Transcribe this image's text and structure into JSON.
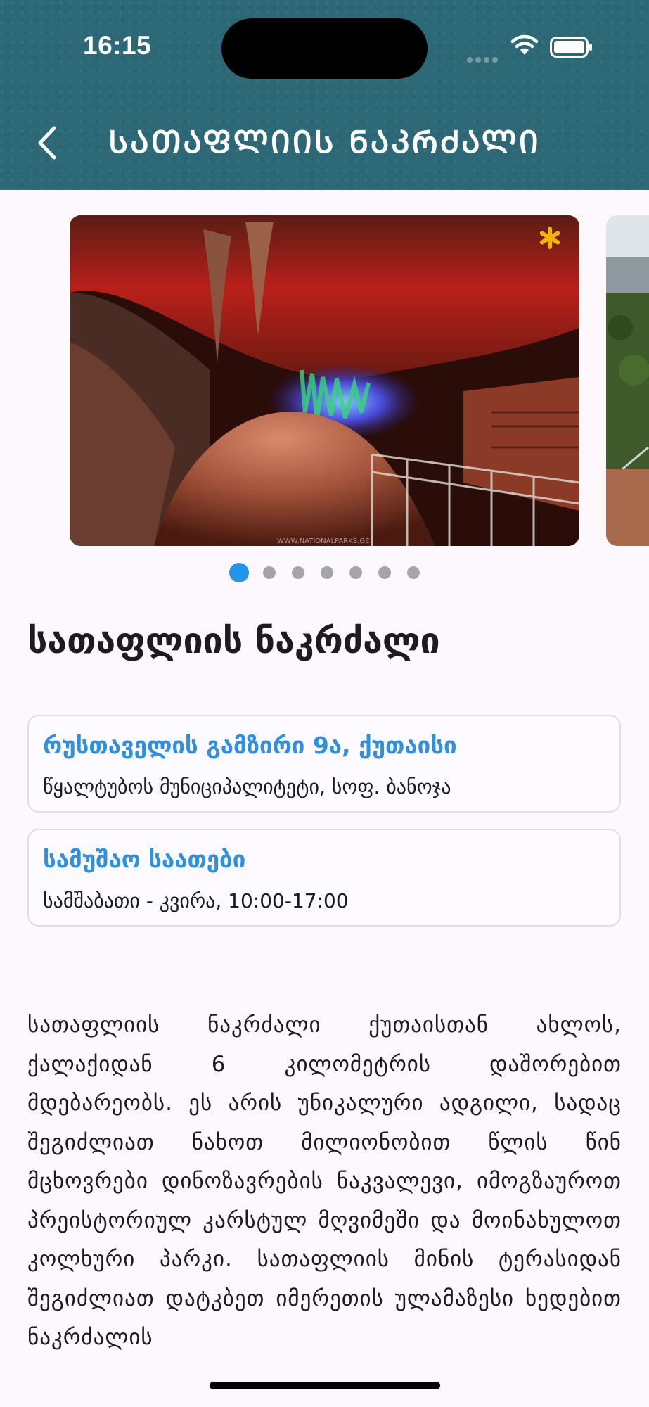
{
  "status_bar": {
    "time": "16:15"
  },
  "header": {
    "title": "ᲡᲐᲗᲐᲤᲚᲘᲘᲡ ᲜᲐᲙᲠᲫᲐᲚᲘ"
  },
  "carousel": {
    "image_count": 7,
    "active_index": 0,
    "watermark": "WWW.NATIONALPARKS.GE"
  },
  "place": {
    "title": "სათაფლიის ნაკრძალი"
  },
  "address": {
    "title": "რუსთაველის გამზირი 9ა, ქუთაისი",
    "subtitle": "წყალტუბოს მუნიციპალიტეტი, სოფ. ბანოჯა"
  },
  "hours": {
    "title": "სამუშაო საათები",
    "value": "სამშაბათი - კვირა, 10:00-17:00"
  },
  "description": "სათაფლიის ნაკრძალი ქუთაისთან ახლოს, ქალაქიდან 6 კილომეტრის დაშორებით მდებარეობს. ეს არის უნიკალური ადგილი, სადაც შეგიძლიათ ნახოთ მილიონობით წლის წინ მცხოვრები დინოზავრების ნაკვალევი, იმოგზაუროთ პრეისტორიულ კარსტულ მღვიმეში და მოინახულოთ კოლხური პარკი. სათაფლიის მინის ტერასიდან შეგიძლიათ დატკბეთ იმერეთის ულამაზესი ხედებით ნაკრძალის",
  "colors": {
    "header_bg": "#2d6877",
    "accent": "#2f8fe0",
    "page_bg": "#fcf8fd",
    "star": "#f5b400"
  }
}
